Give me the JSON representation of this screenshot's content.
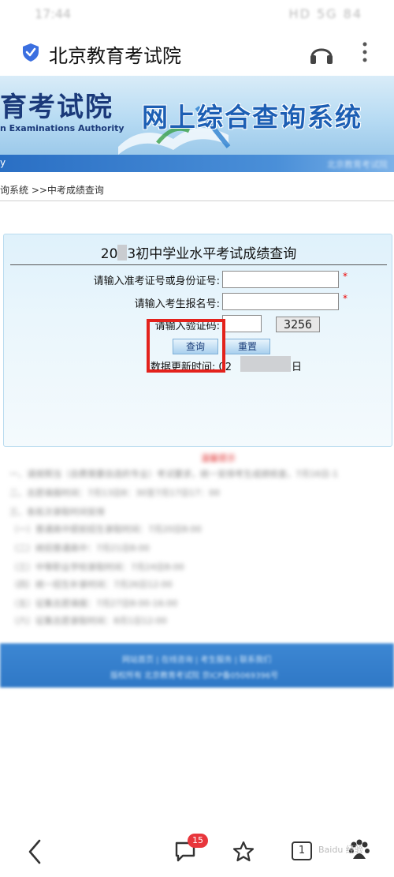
{
  "status_bar": {
    "time": "17:44",
    "icons": "HD 5G 84"
  },
  "browser": {
    "site_title": "北京教育考试院",
    "tab_count": "1",
    "message_badge": "15"
  },
  "banner": {
    "logo_cn": "育考试院",
    "logo_en": "n Examinations Authority",
    "system_title": "网上综合查询系统",
    "nav_fragment": "y",
    "nav_right": "北京教育考试院"
  },
  "breadcrumb": "询系统 >>中考成绩查询",
  "form": {
    "title_prefix": "20",
    "title_suffix": "3初中学业水平考试成绩查询",
    "id_label": "请输入准考证号或身份证号:",
    "reg_label": "请输入考生报名号:",
    "captcha_label": "请输入验证码:",
    "captcha_value": "3256",
    "required_mark": "*",
    "query_button": "查询",
    "reset_button": "重置",
    "update_label": "数据更新时间:",
    "update_prefix": "02",
    "update_suffix": "日"
  },
  "notice": {
    "head": "温馨提示",
    "lines": [
      "一、请按照当（自费需要自选的专业）考试要求，统一安排考生成绩核查，7月16日-1",
      "二、志愿填报时间：7月13日8：30至7月17日17：00",
      "三、各批次录取时间安排",
      "（一）普通高中提前招生录取时间：7月20日8:00",
      "（二）统招普通高中：7月21日8:00",
      "（三）中等职业学校录取时间：7月24日8:00",
      "（四）统一招生补录时间：7月26日12:00",
      "（五）征集志愿填报：7月27日8:00-16:00",
      "（六）征集志愿录取时间：8月1日12:00"
    ]
  },
  "footer": {
    "line1": "网站首页 | 在线咨询 | 考生服务 | 联系我们",
    "line2": "版权所有 北京教育考试院 京ICP备05069396号"
  },
  "watermark": "Baidu 经验",
  "colors": {
    "accent": "#1d5fb4",
    "highlight_box": "#e3221c",
    "required": "#e00000",
    "footer": "#2f78c6"
  }
}
